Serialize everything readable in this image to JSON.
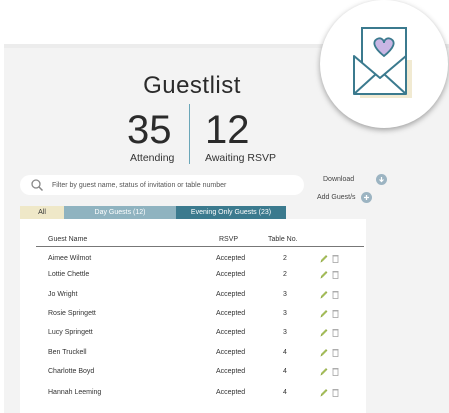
{
  "page": {
    "title": "Guestlist"
  },
  "stats": {
    "attending_count": "35",
    "attending_label": "Attending",
    "awaiting_count": "12",
    "awaiting_label": "Awaiting RSVP"
  },
  "search": {
    "placeholder": "Filter by guest name, status of invitation or table number",
    "icon": "search-icon"
  },
  "actions": {
    "download_label": "Download",
    "add_guest_label": "Add Guest/s"
  },
  "tabs": [
    {
      "label": "All"
    },
    {
      "label": "Day Guests (12)"
    },
    {
      "label": "Evening Only Guests (23)"
    }
  ],
  "table": {
    "columns": [
      "Guest Name",
      "RSVP",
      "Table No."
    ],
    "rows": [
      {
        "name": "Aimee Wilmot",
        "rsvp": "Accepted",
        "table": "2"
      },
      {
        "name": "Lottie Chettle",
        "rsvp": "Accepted",
        "table": "2"
      },
      {
        "name": "Jo Wright",
        "rsvp": "Accepted",
        "table": "3"
      },
      {
        "name": "Rosie Springett",
        "rsvp": "Accepted",
        "table": "3"
      },
      {
        "name": "Lucy Springett",
        "rsvp": "Accepted",
        "table": "3"
      },
      {
        "name": "Ben Truckell",
        "rsvp": "Accepted",
        "table": "4"
      },
      {
        "name": "Charlotte Boyd",
        "rsvp": "Accepted",
        "table": "4"
      },
      {
        "name": "Hannah Leeming",
        "rsvp": "Accepted",
        "table": "4"
      }
    ]
  },
  "colors": {
    "accent_dark": "#3b7a8e",
    "accent_light": "#8fb3c0",
    "tab_all": "#efe8c8",
    "divider": "#6aa6b8",
    "envelope_heart": "#c9b6e4"
  },
  "icons": {
    "badge": "envelope-heart-icon",
    "download": "download-icon",
    "add": "plus-icon",
    "edit": "pencil-icon",
    "delete": "trash-icon"
  }
}
